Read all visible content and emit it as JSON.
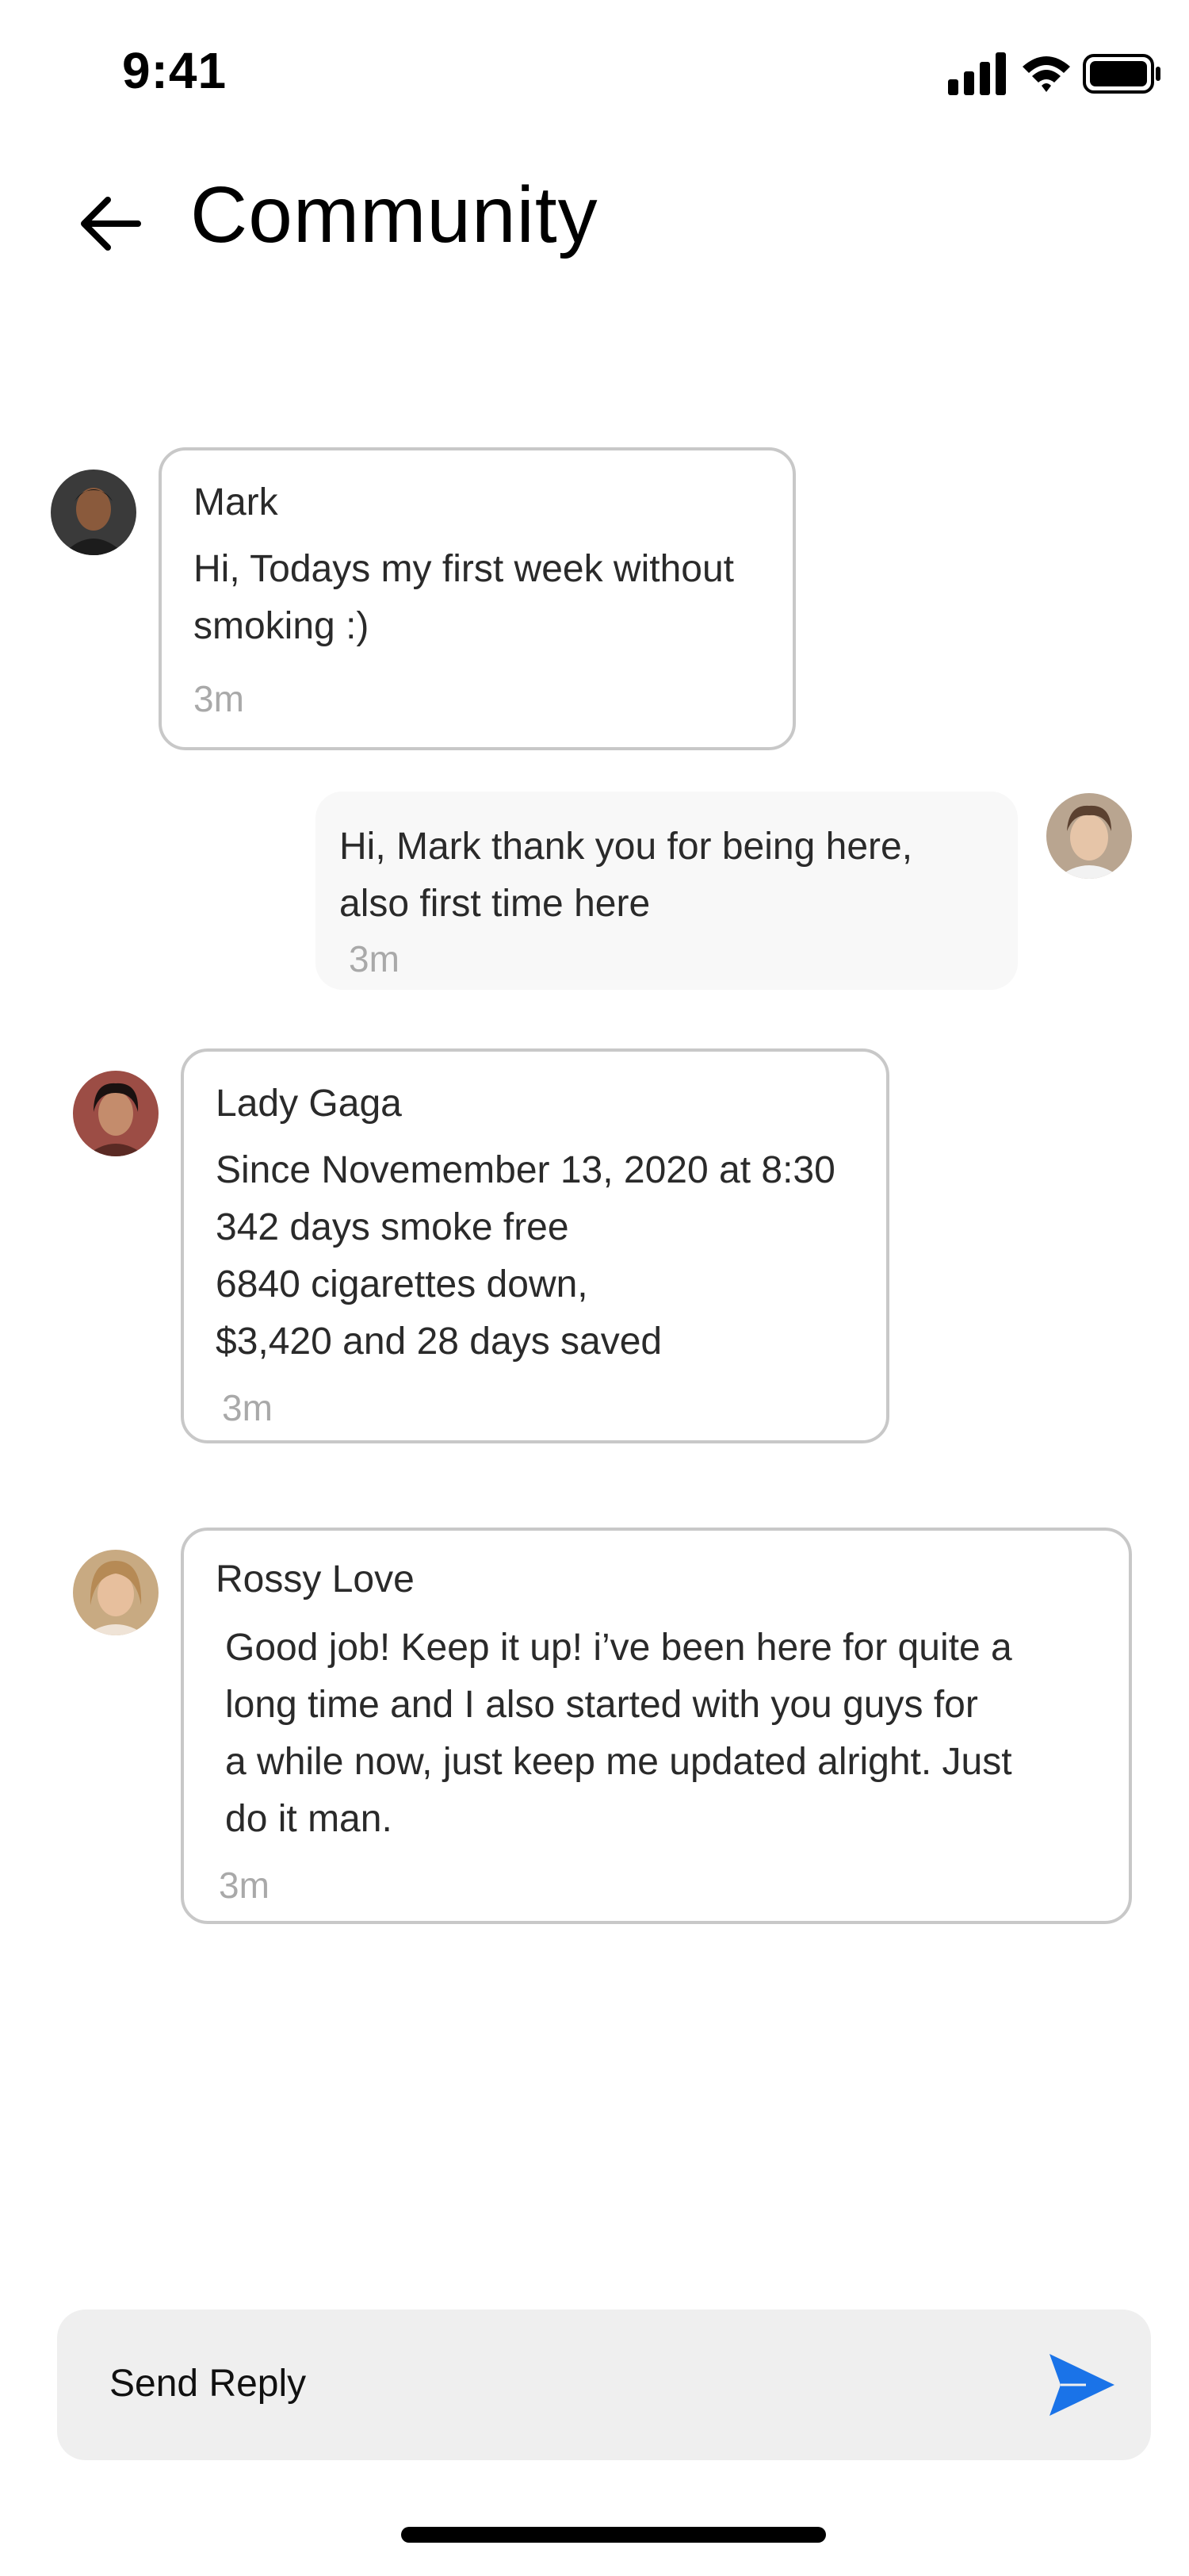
{
  "status_bar": {
    "time": "9:41",
    "icons": [
      "cellular-signal-icon",
      "wifi-icon",
      "battery-icon"
    ]
  },
  "header": {
    "back_icon": "arrow-left-icon",
    "title": "Community"
  },
  "messages": [
    {
      "sender": "Mark",
      "lines": [
        "Hi, Todays my first week without",
        "smoking :)"
      ],
      "time": "3m",
      "own": false
    },
    {
      "sender": "",
      "lines": [
        "Hi, Mark thank you for being here,",
        "also first time here"
      ],
      "time": "3m",
      "own": true
    },
    {
      "sender": "Lady Gaga",
      "lines": [
        "Since Novemember 13, 2020 at 8:30",
        "342 days smoke free",
        "6840 cigarettes down,",
        "$3,420 and 28 days saved"
      ],
      "time": "3m",
      "own": false
    },
    {
      "sender": "Rossy Love",
      "lines": [
        "Good job! Keep it up! i’ve been here for quite a",
        "long time and I also started with you guys for",
        "a while now, just keep me updated alright. Just",
        "do it man."
      ],
      "time": "3m",
      "own": false
    }
  ],
  "reply": {
    "placeholder": "Send Reply",
    "send_icon": "send-icon"
  },
  "colors": {
    "accent": "#1a73e8",
    "bubble_border": "#c8c8c8",
    "own_bubble_bg": "#f8f8f8",
    "reply_bar_bg": "#efefef",
    "timestamp": "#a9a9a9"
  }
}
